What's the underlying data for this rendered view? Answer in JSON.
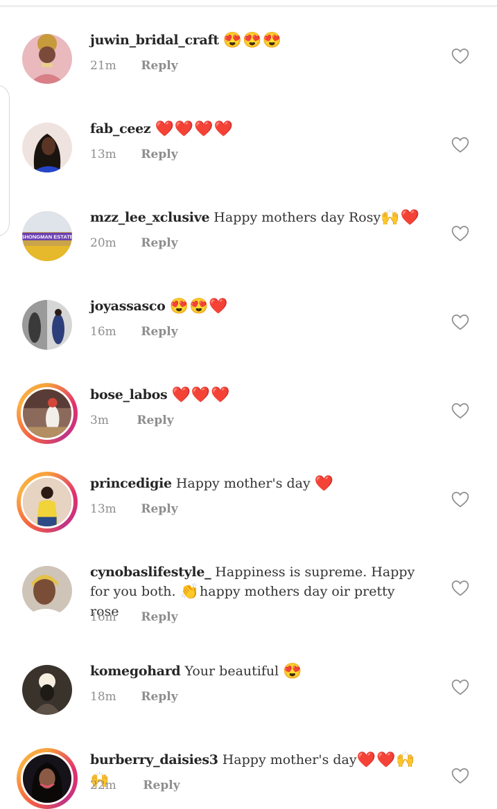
{
  "ui": {
    "reply_label": "Reply"
  },
  "comments": [
    {
      "username": "juwin_bridal_craft",
      "text": "",
      "emoji": "😍😍😍",
      "time": "21m",
      "avatar": "bridal-portrait",
      "story": false
    },
    {
      "username": "fab_ceez",
      "text": "",
      "emoji": "❤️❤️❤️❤️",
      "time": "13m",
      "avatar": "woman-portrait",
      "story": false
    },
    {
      "username": "mzz_lee_xclusive",
      "text": "Happy mothers day Rosy",
      "emoji": "🙌❤️",
      "time": "20m",
      "avatar": "ashongman-estates-logo",
      "avatar_text": "ASHONGMAN ESTATES",
      "story": false
    },
    {
      "username": "joyassasco",
      "text": "",
      "emoji": "😍😍❤️",
      "time": "16m",
      "avatar": "collage-photo",
      "story": false
    },
    {
      "username": "bose_labos",
      "text": "",
      "emoji": "❤️❤️❤️",
      "time": "3m",
      "avatar": "woman-outdoor-photo",
      "story": true
    },
    {
      "username": "princedigie",
      "text": "Happy mother's day",
      "emoji": "❤️",
      "time": "13m",
      "avatar": "man-yellow-shirt",
      "story": true
    },
    {
      "username": "cynobaslifestyle_",
      "text": "Happiness is supreme. Happy for you both.",
      "emoji": "👏",
      "text2": "happy mothers day oir pretty rose",
      "time": "16m",
      "avatar": "woman-selfie",
      "story": false
    },
    {
      "username": "komegohard",
      "text": "Your beautiful",
      "emoji": "😍",
      "time": "18m",
      "avatar": "dark-photo",
      "story": false
    },
    {
      "username": "burberry_daisies3",
      "text": "Happy mother's day",
      "emoji": "❤️❤️🙌🙌",
      "time": "22m",
      "avatar": "woman-portrait-2",
      "story": true
    }
  ]
}
